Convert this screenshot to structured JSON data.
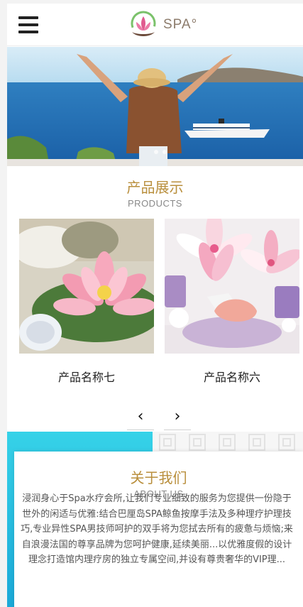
{
  "header": {
    "menu_icon": "hamburger-menu-icon",
    "logo_text": "SPA°",
    "logo_icon": "lotus-logo-icon"
  },
  "banner": {
    "image": "woman-waving-at-cruise-ship-photo"
  },
  "products": {
    "title": "产品展示",
    "subtitle": "PRODUCTS",
    "items": [
      {
        "name": "产品名称七",
        "image": "pink-lotus-flower-spa-photo"
      },
      {
        "name": "产品名称六",
        "image": "lily-flowers-bath-salts-photo"
      }
    ],
    "prev_icon": "chevron-left-icon",
    "next_icon": "chevron-right-icon",
    "prev_label": "‹",
    "next_label": "›"
  },
  "about": {
    "title": "关于我们",
    "subtitle": "ABOUT US",
    "text": "浸润身心于Spa水疗会所,让我们专业细致的服务为您提供一份隐于世外的闲适与优雅:结合巴厘岛SPA鲸鱼按摩手法及多种理疗护理技巧,专业异性SPA男技师呵护的双手将为您拭去所有的疲惫与烦恼;来自浪漫法国的尊享品牌为您呵护健康,延续美丽...以优雅度假的设计理念打造馆内理疗房的独立专属空间,并设有尊贵奢华的VIP理..."
  },
  "colors": {
    "accent_gold": "#b98f3d",
    "about_blue": "#1aa9d8"
  }
}
